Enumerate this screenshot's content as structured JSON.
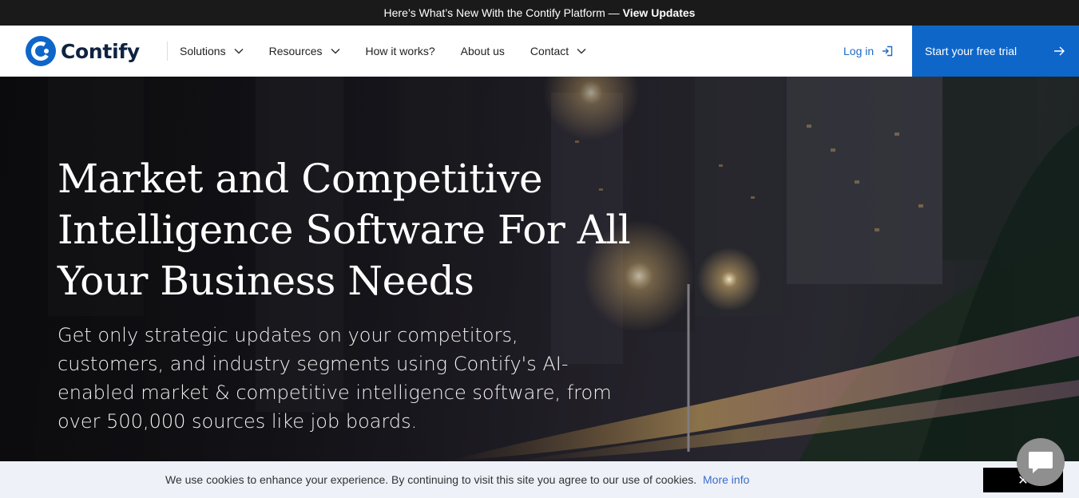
{
  "announcement": {
    "lead": "Here’s What’s New With the Contify Platform —",
    "link": "View Updates"
  },
  "nav": {
    "logo_text": "Contify",
    "items": [
      {
        "label": "Solutions",
        "has_dropdown": true
      },
      {
        "label": "Resources",
        "has_dropdown": true
      },
      {
        "label": "How it works?",
        "has_dropdown": false
      },
      {
        "label": "About us",
        "has_dropdown": false
      },
      {
        "label": "Contact",
        "has_dropdown": true
      }
    ],
    "login": "Log in",
    "cta": "Start your free trial"
  },
  "hero": {
    "title": "Market and Competitive Intelligence Software For All Your Business Needs",
    "subtitle": "Get only strategic updates on your competitors, customers, and industry segments using Contify's AI-enabled market & competitive intelligence software, from over 500,000 sources like job boards."
  },
  "cookie": {
    "text": "We use cookies to enhance your experience. By continuing to visit this site you agree to our use of cookies.",
    "link": "More info",
    "close": "✕"
  },
  "colors": {
    "brand_blue": "#0e66c9",
    "logo_navy": "#0f2340",
    "login_blue": "#1f6bc2",
    "cookie_bg": "#eef1f8"
  },
  "icons": [
    "contify-logo-icon",
    "chevron-down-icon",
    "login-arrow-icon",
    "arrow-right-icon",
    "chat-bubble-icon",
    "close-icon"
  ]
}
